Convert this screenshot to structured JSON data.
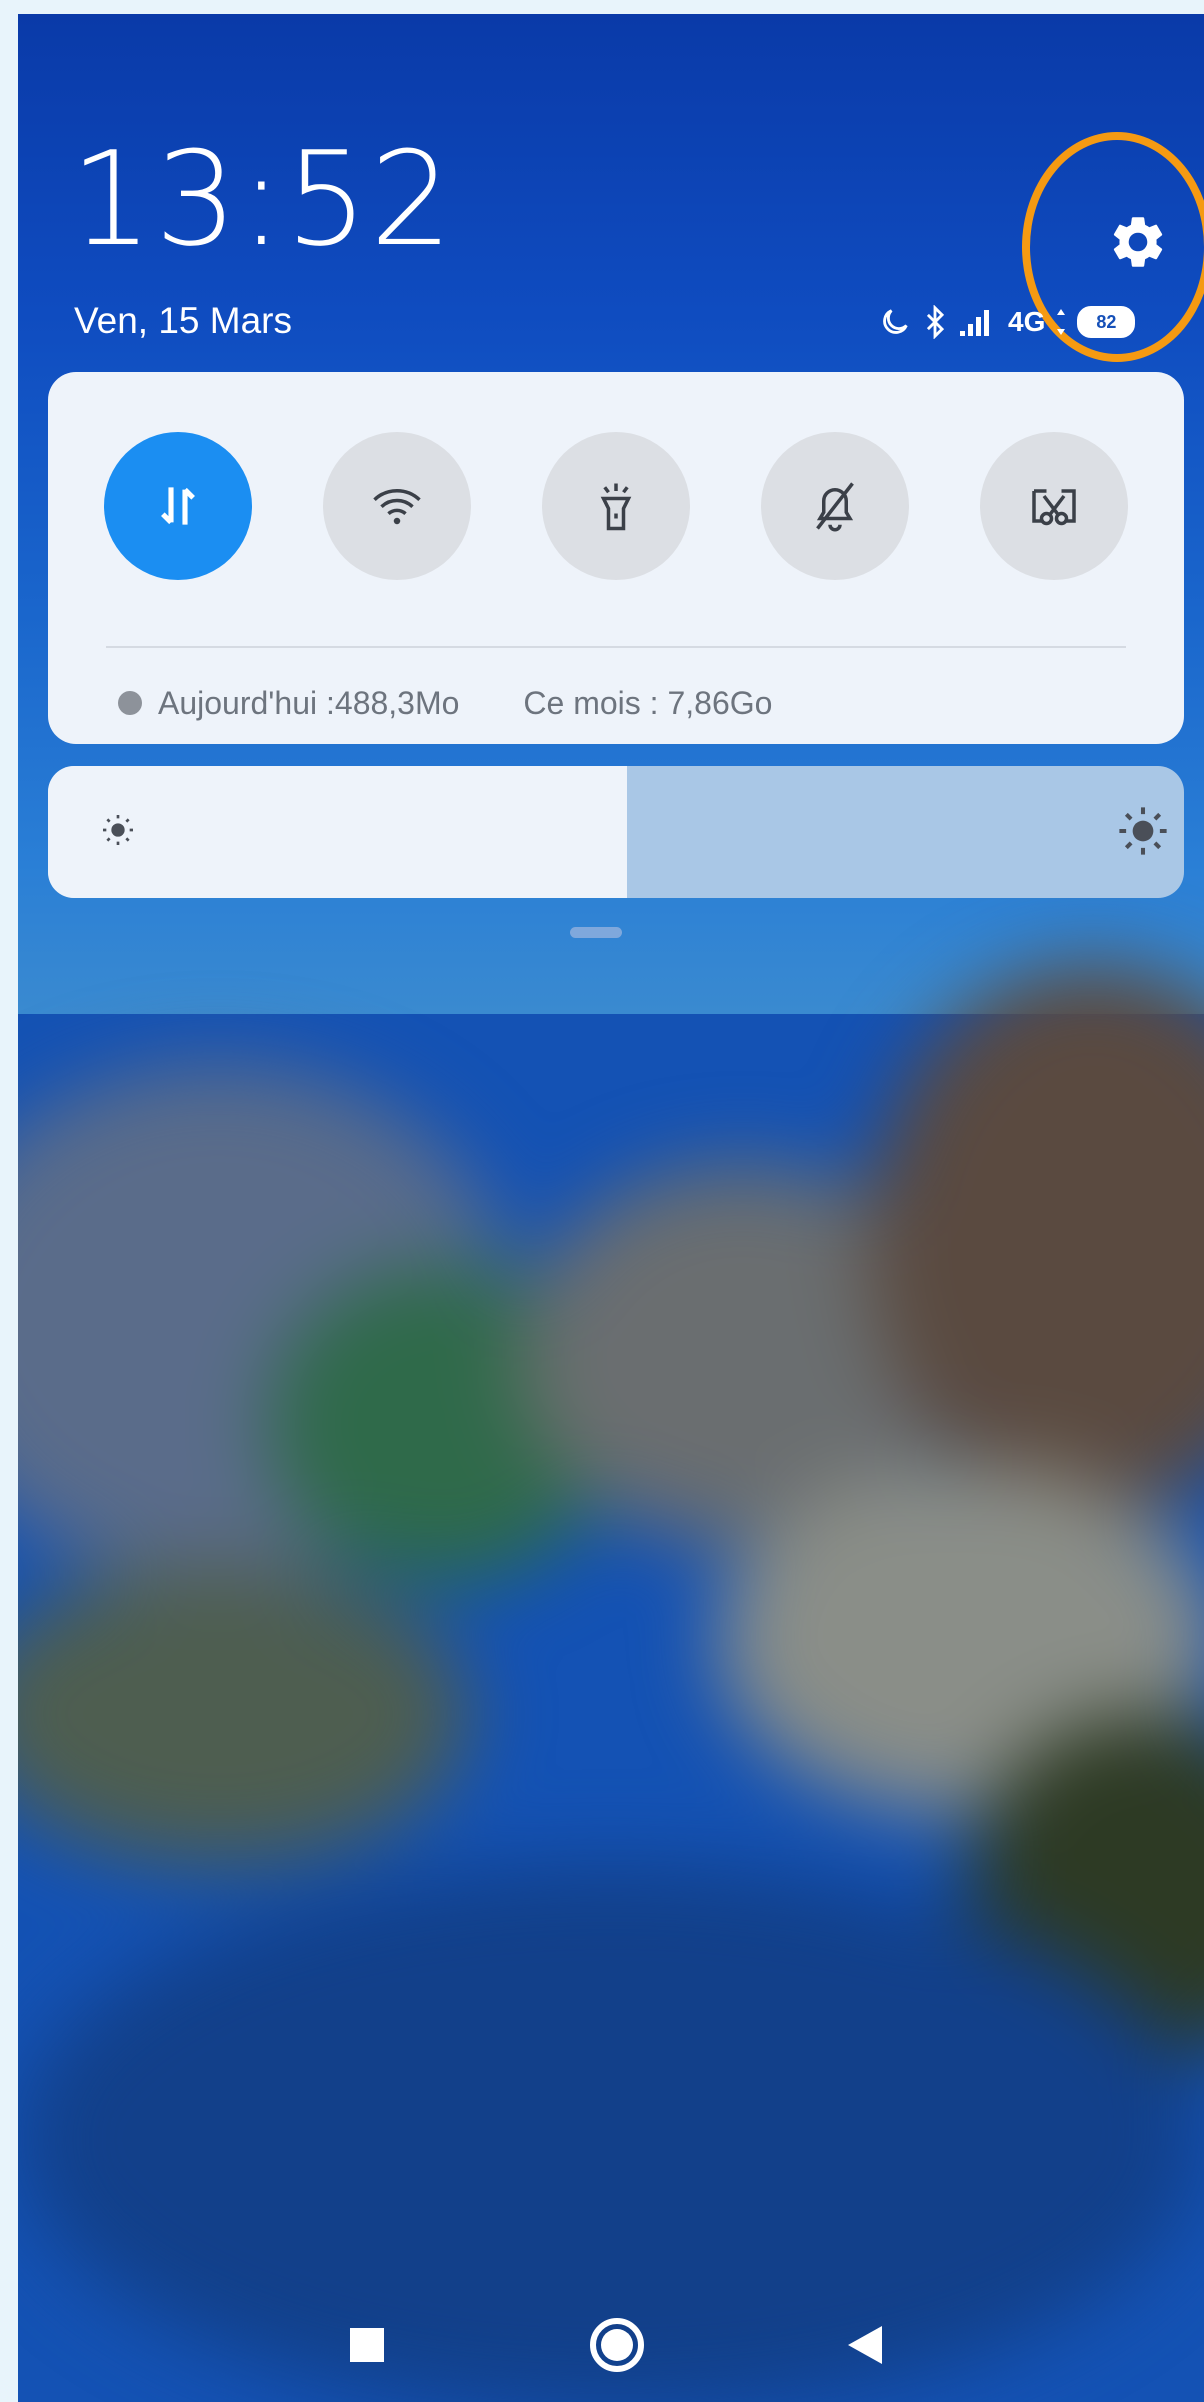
{
  "status": {
    "time": "13:52",
    "date": "Ven, 15 Mars",
    "network": "4G",
    "battery": "82"
  },
  "quick_tiles": [
    {
      "name": "mobile-data",
      "icon": "data-arrows-icon",
      "active": true
    },
    {
      "name": "wifi",
      "icon": "wifi-icon",
      "active": false
    },
    {
      "name": "flashlight",
      "icon": "flashlight-icon",
      "active": false
    },
    {
      "name": "mute",
      "icon": "bell-off-icon",
      "active": false
    },
    {
      "name": "screenshot",
      "icon": "scissors-icon",
      "active": false
    }
  ],
  "data_usage": {
    "today": "Aujourd'hui :488,3Mo",
    "month": "Ce mois : 7,86Go"
  },
  "brightness": {
    "level": 0.51
  },
  "colors": {
    "accent": "#1b8ef2",
    "highlight": "#f59a12",
    "panel": "#eef3fa"
  }
}
